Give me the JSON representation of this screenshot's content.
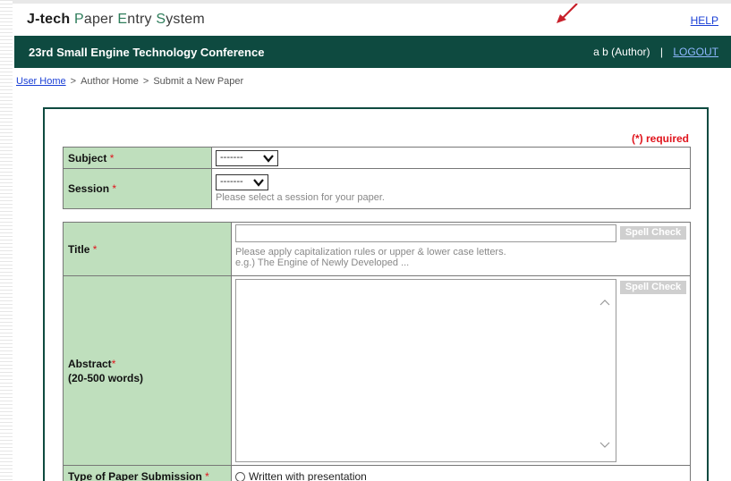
{
  "header": {
    "brand": {
      "p1": "J-tech",
      "p2": "P",
      "p3": "aper",
      "p4": "E",
      "p5": "ntry",
      "p6": "S",
      "p7": "ystem"
    },
    "help_label": "HELP"
  },
  "conference": {
    "title": "23rd Small Engine Technology Conference",
    "user": "a b (Author)",
    "separator": "|",
    "logout_label": "LOGOUT"
  },
  "breadcrumb": {
    "items": [
      "User Home",
      "Author Home",
      "Submit a New Paper"
    ],
    "separator": ">"
  },
  "form": {
    "required_note": "(*) required",
    "required_mark": "*",
    "subject": {
      "label": "Subject",
      "value": "-------"
    },
    "session": {
      "label": "Session",
      "value": "-------",
      "hint": "Please select a session for your paper."
    },
    "title": {
      "label": "Title",
      "value": "",
      "hint_line1": "Please apply capitalization rules or upper & lower case letters.",
      "hint_line2": "e.g.) The Engine of Newly Developed ..."
    },
    "spell_check_label": "Spell Check",
    "abstract": {
      "label": "Abstract",
      "sublabel": "(20-500 words)",
      "value": ""
    },
    "paper_type": {
      "label": "Type of Paper Submission",
      "option": "Written with presentation"
    }
  },
  "colors": {
    "conference_bar": "#0e4a40",
    "label_cell": "#bfdfbd",
    "required": "#e0141c",
    "link": "#1a3fd6"
  },
  "icons": [
    "chevron-down-icon",
    "red-arrow-icon",
    "radio-icon"
  ]
}
